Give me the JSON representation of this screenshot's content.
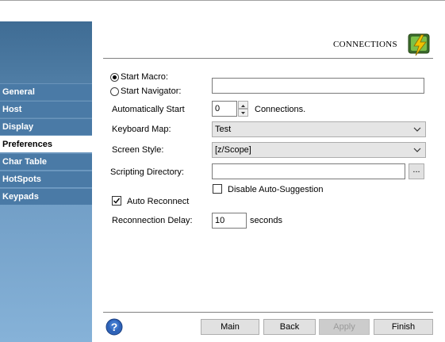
{
  "header": {
    "title": "CONNECTIONS",
    "icon": "connections-icon"
  },
  "sidebar": {
    "items": [
      {
        "label": "General",
        "active": false
      },
      {
        "label": "Host",
        "active": false
      },
      {
        "label": "Display",
        "active": false
      },
      {
        "label": "Preferences",
        "active": true
      },
      {
        "label": "Char Table",
        "active": false
      },
      {
        "label": "HotSpots",
        "active": false
      },
      {
        "label": "Keypads",
        "active": false
      }
    ]
  },
  "form": {
    "start_macro_label": "Start Macro:",
    "start_navigator_label": "Start Navigator:",
    "start_macro_value": "",
    "auto_start_label": "Automatically Start",
    "auto_start_value": "0",
    "auto_start_suffix": "Connections.",
    "keyboard_map_label": "Keyboard Map:",
    "keyboard_map_value": "Test",
    "screen_style_label": "Screen Style:",
    "screen_style_value": "[z/Scope]",
    "scripting_dir_label": "Scripting Directory:",
    "scripting_dir_value": "",
    "browse_label": "...",
    "disable_autosuggest_label": "Disable Auto-Suggestion",
    "disable_autosuggest_checked": false,
    "auto_reconnect_label": "Auto Reconnect",
    "auto_reconnect_checked": true,
    "reconnect_delay_label": "Reconnection Delay:",
    "reconnect_delay_value": "10",
    "reconnect_delay_suffix": "seconds"
  },
  "footer": {
    "main_label": "Main",
    "back_label": "Back",
    "apply_label": "Apply",
    "finish_label": "Finish",
    "help_icon": "help-icon"
  },
  "colors": {
    "sidebar": "#4a7aa6",
    "accent": "#f2c200"
  }
}
